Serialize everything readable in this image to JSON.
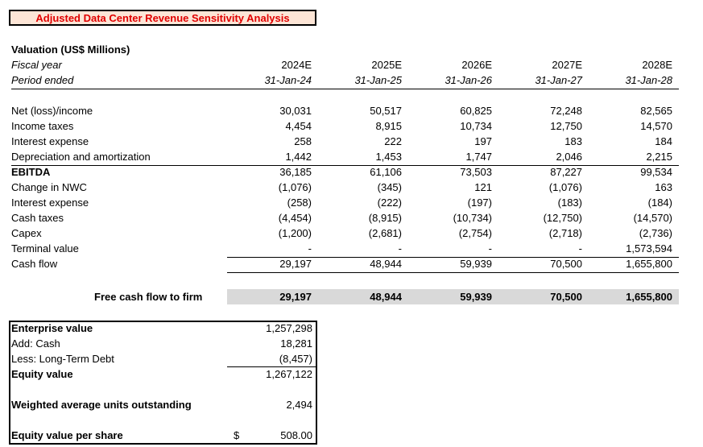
{
  "title": "Adjusted Data Center Revenue Sensitivity Analysis",
  "header": {
    "section": "Valuation (US$ Millions)",
    "fiscal_year_label": "Fiscal year",
    "period_ended_label": "Period ended",
    "years": [
      "2024E",
      "2025E",
      "2026E",
      "2027E",
      "2028E"
    ],
    "periods": [
      "31-Jan-24",
      "31-Jan-25",
      "31-Jan-26",
      "31-Jan-27",
      "31-Jan-28"
    ]
  },
  "rows": [
    {
      "label": "Net (loss)/income",
      "values": [
        "30,031",
        "50,517",
        "60,825",
        "72,248",
        "82,565"
      ]
    },
    {
      "label": "Income taxes",
      "values": [
        "4,454",
        "8,915",
        "10,734",
        "12,750",
        "14,570"
      ]
    },
    {
      "label": "Interest expense",
      "values": [
        "258",
        "222",
        "197",
        "183",
        "184"
      ]
    },
    {
      "label": "Depreciation and amortization",
      "values": [
        "1,442",
        "1,453",
        "1,747",
        "2,046",
        "2,215"
      ]
    },
    {
      "label": "EBITDA",
      "values": [
        "36,185",
        "61,106",
        "73,503",
        "87,227",
        "99,534"
      ]
    },
    {
      "label": "Change in NWC",
      "values": [
        "(1,076)",
        "(345)",
        "121",
        "(1,076)",
        "163"
      ]
    },
    {
      "label": "Interest expense",
      "values": [
        "(258)",
        "(222)",
        "(197)",
        "(183)",
        "(184)"
      ]
    },
    {
      "label": "Cash taxes",
      "values": [
        "(4,454)",
        "(8,915)",
        "(10,734)",
        "(12,750)",
        "(14,570)"
      ]
    },
    {
      "label": "Capex",
      "values": [
        "(1,200)",
        "(2,681)",
        "(2,754)",
        "(2,718)",
        "(2,736)"
      ]
    },
    {
      "label": "Terminal value",
      "values": [
        "-",
        "-",
        "-",
        "-",
        "1,573,594"
      ]
    },
    {
      "label": "Cash flow",
      "values": [
        "29,197",
        "48,944",
        "59,939",
        "70,500",
        "1,655,800"
      ]
    }
  ],
  "fcf": {
    "label": "Free cash flow to firm",
    "values": [
      "29,197",
      "48,944",
      "59,939",
      "70,500",
      "1,655,800"
    ]
  },
  "equity": {
    "ev_label": "Enterprise value",
    "ev": "1,257,298",
    "cash_label": "Add: Cash",
    "cash": "18,281",
    "debt_label": "Less: Long-Term Debt",
    "debt": "(8,457)",
    "equity_label": "Equity value",
    "equity": "1,267,122",
    "units_label": "Weighted average units outstanding",
    "units": "2,494",
    "per_share_label": "Equity value per share",
    "currency": "$",
    "per_share": "508.00"
  }
}
